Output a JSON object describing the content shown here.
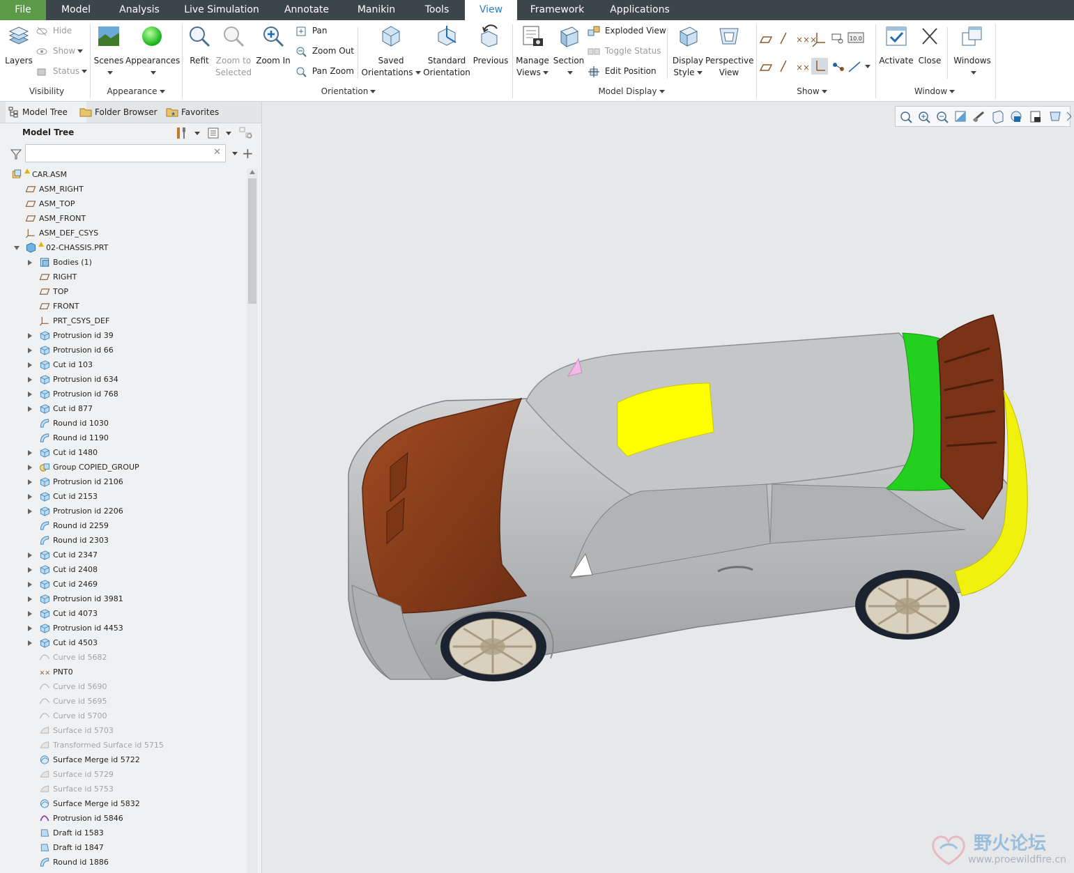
{
  "menu": {
    "tabs": [
      {
        "label": "File"
      },
      {
        "label": "Model"
      },
      {
        "label": "Analysis"
      },
      {
        "label": "Live Simulation"
      },
      {
        "label": "Annotate"
      },
      {
        "label": "Manikin"
      },
      {
        "label": "Tools"
      },
      {
        "label": "View"
      },
      {
        "label": "Framework"
      },
      {
        "label": "Applications"
      }
    ],
    "active": "View"
  },
  "ribbon": {
    "visibility": {
      "layers": "Layers",
      "hide": "Hide",
      "show": "Show",
      "status": "Status",
      "group": "Visibility"
    },
    "appearance": {
      "scenes": "Scenes",
      "appearances": "Appearances",
      "group": "Appearance"
    },
    "orientation": {
      "refit": "Refit",
      "zoom_to_selected_1": "Zoom to",
      "zoom_to_selected_2": "Selected",
      "zoom_in": "Zoom In",
      "pan": "Pan",
      "zoom_out": "Zoom Out",
      "pan_zoom": "Pan Zoom",
      "saved_1": "Saved",
      "saved_2": "Orientations",
      "standard_1": "Standard",
      "standard_2": "Orientation",
      "previous": "Previous",
      "group": "Orientation"
    },
    "model_display": {
      "manage_1": "Manage",
      "manage_2": "Views",
      "section": "Section",
      "exploded_view": "Exploded View",
      "toggle_status": "Toggle Status",
      "edit_position": "Edit Position",
      "display_1": "Display",
      "display_2": "Style",
      "perspective_1": "Perspective",
      "perspective_2": "View",
      "group": "Model Display"
    },
    "show": {
      "group": "Show",
      "value_badge": "10.0"
    },
    "window": {
      "activate": "Activate",
      "close": "Close",
      "windows": "Windows",
      "group": "Window"
    }
  },
  "panel": {
    "tabs": [
      {
        "label": "Model Tree"
      },
      {
        "label": "Folder Browser"
      },
      {
        "label": "Favorites"
      }
    ],
    "tree_title": "Model Tree",
    "search_value": "",
    "rows": [
      {
        "label": "CAR.ASM",
        "level": 0,
        "icon": "assembly",
        "expand": "none",
        "dim": false,
        "warn": true
      },
      {
        "label": "ASM_RIGHT",
        "level": 1,
        "icon": "plane",
        "expand": "none",
        "dim": false
      },
      {
        "label": "ASM_TOP",
        "level": 1,
        "icon": "plane",
        "expand": "none",
        "dim": false
      },
      {
        "label": "ASM_FRONT",
        "level": 1,
        "icon": "plane",
        "expand": "none",
        "dim": false
      },
      {
        "label": "ASM_DEF_CSYS",
        "level": 1,
        "icon": "csys",
        "expand": "none",
        "dim": false
      },
      {
        "label": "02-CHASSIS.PRT",
        "level": 1,
        "icon": "part",
        "expand": "open",
        "dim": false,
        "warn": true
      },
      {
        "label": "Bodies (1)",
        "level": 2,
        "icon": "bodies",
        "expand": "closed",
        "dim": false
      },
      {
        "label": "RIGHT",
        "level": 2,
        "icon": "plane",
        "expand": "none",
        "dim": false
      },
      {
        "label": "TOP",
        "level": 2,
        "icon": "plane",
        "expand": "none",
        "dim": false
      },
      {
        "label": "FRONT",
        "level": 2,
        "icon": "plane",
        "expand": "none",
        "dim": false
      },
      {
        "label": "PRT_CSYS_DEF",
        "level": 2,
        "icon": "csys",
        "expand": "none",
        "dim": false
      },
      {
        "label": "Protrusion id 39",
        "level": 2,
        "icon": "feature",
        "expand": "closed",
        "dim": false
      },
      {
        "label": "Protrusion id 66",
        "level": 2,
        "icon": "feature",
        "expand": "closed",
        "dim": false
      },
      {
        "label": "Cut id 103",
        "level": 2,
        "icon": "feature",
        "expand": "closed",
        "dim": false
      },
      {
        "label": "Protrusion id 634",
        "level": 2,
        "icon": "feature",
        "expand": "closed",
        "dim": false
      },
      {
        "label": "Protrusion id 768",
        "level": 2,
        "icon": "feature",
        "expand": "closed",
        "dim": false
      },
      {
        "label": "Cut id 877",
        "level": 2,
        "icon": "feature",
        "expand": "closed",
        "dim": false
      },
      {
        "label": "Round id 1030",
        "level": 2,
        "icon": "round",
        "expand": "none",
        "dim": false
      },
      {
        "label": "Round id 1190",
        "level": 2,
        "icon": "round",
        "expand": "none",
        "dim": false
      },
      {
        "label": "Cut id 1480",
        "level": 2,
        "icon": "feature",
        "expand": "closed",
        "dim": false
      },
      {
        "label": "Group COPIED_GROUP",
        "level": 2,
        "icon": "group",
        "expand": "closed",
        "dim": false
      },
      {
        "label": "Protrusion id 2106",
        "level": 2,
        "icon": "feature",
        "expand": "closed",
        "dim": false
      },
      {
        "label": "Cut id 2153",
        "level": 2,
        "icon": "feature",
        "expand": "closed",
        "dim": false
      },
      {
        "label": "Protrusion id 2206",
        "level": 2,
        "icon": "feature",
        "expand": "closed",
        "dim": false
      },
      {
        "label": "Round id 2259",
        "level": 2,
        "icon": "round",
        "expand": "none",
        "dim": false
      },
      {
        "label": "Round id 2303",
        "level": 2,
        "icon": "round",
        "expand": "none",
        "dim": false
      },
      {
        "label": "Cut id 2347",
        "level": 2,
        "icon": "feature",
        "expand": "closed",
        "dim": false
      },
      {
        "label": "Cut id 2408",
        "level": 2,
        "icon": "feature",
        "expand": "closed",
        "dim": false
      },
      {
        "label": "Cut id 2469",
        "level": 2,
        "icon": "feature",
        "expand": "closed",
        "dim": false
      },
      {
        "label": "Protrusion id 3981",
        "level": 2,
        "icon": "feature",
        "expand": "closed",
        "dim": false
      },
      {
        "label": "Cut id 4073",
        "level": 2,
        "icon": "feature",
        "expand": "closed",
        "dim": false
      },
      {
        "label": "Protrusion id 4453",
        "level": 2,
        "icon": "feature",
        "expand": "closed",
        "dim": false
      },
      {
        "label": "Cut id 4503",
        "level": 2,
        "icon": "feature",
        "expand": "closed",
        "dim": false
      },
      {
        "label": "Curve id 5682",
        "level": 2,
        "icon": "curve",
        "expand": "none",
        "dim": true
      },
      {
        "label": "PNT0",
        "level": 2,
        "icon": "point",
        "expand": "none",
        "dim": false
      },
      {
        "label": "Curve id 5690",
        "level": 2,
        "icon": "curve",
        "expand": "none",
        "dim": true
      },
      {
        "label": "Curve id 5695",
        "level": 2,
        "icon": "curve",
        "expand": "none",
        "dim": true
      },
      {
        "label": "Curve id 5700",
        "level": 2,
        "icon": "curve",
        "expand": "none",
        "dim": true
      },
      {
        "label": "Surface id 5703",
        "level": 2,
        "icon": "surface",
        "expand": "none",
        "dim": true
      },
      {
        "label": "Transformed Surface id 5715",
        "level": 2,
        "icon": "surface",
        "expand": "none",
        "dim": true
      },
      {
        "label": "Surface Merge id 5722",
        "level": 2,
        "icon": "merge",
        "expand": "none",
        "dim": false
      },
      {
        "label": "Surface id 5729",
        "level": 2,
        "icon": "surface",
        "expand": "none",
        "dim": true
      },
      {
        "label": "Surface id 5753",
        "level": 2,
        "icon": "surface",
        "expand": "none",
        "dim": true
      },
      {
        "label": "Surface Merge id 5832",
        "level": 2,
        "icon": "merge",
        "expand": "none",
        "dim": false
      },
      {
        "label": "Protrusion id 5846",
        "level": 2,
        "icon": "protrusion2",
        "expand": "none",
        "dim": false
      },
      {
        "label": "Draft id 1583",
        "level": 2,
        "icon": "draft",
        "expand": "none",
        "dim": false
      },
      {
        "label": "Draft id 1847",
        "level": 2,
        "icon": "draft",
        "expand": "none",
        "dim": false
      },
      {
        "label": "Round id 1886",
        "level": 2,
        "icon": "round",
        "expand": "none",
        "dim": false
      }
    ]
  },
  "viewport": {
    "model_colors": {
      "body": "#b9bbbd",
      "hood": "#8a3f1c",
      "roof_panel": "#ffff00",
      "rear_roof": "#22d01d",
      "bumper": "#f1f10e",
      "spoiler": "#7a3316"
    }
  },
  "watermark": {
    "title": "野火论坛",
    "url": "www.proewildfire.cn"
  }
}
